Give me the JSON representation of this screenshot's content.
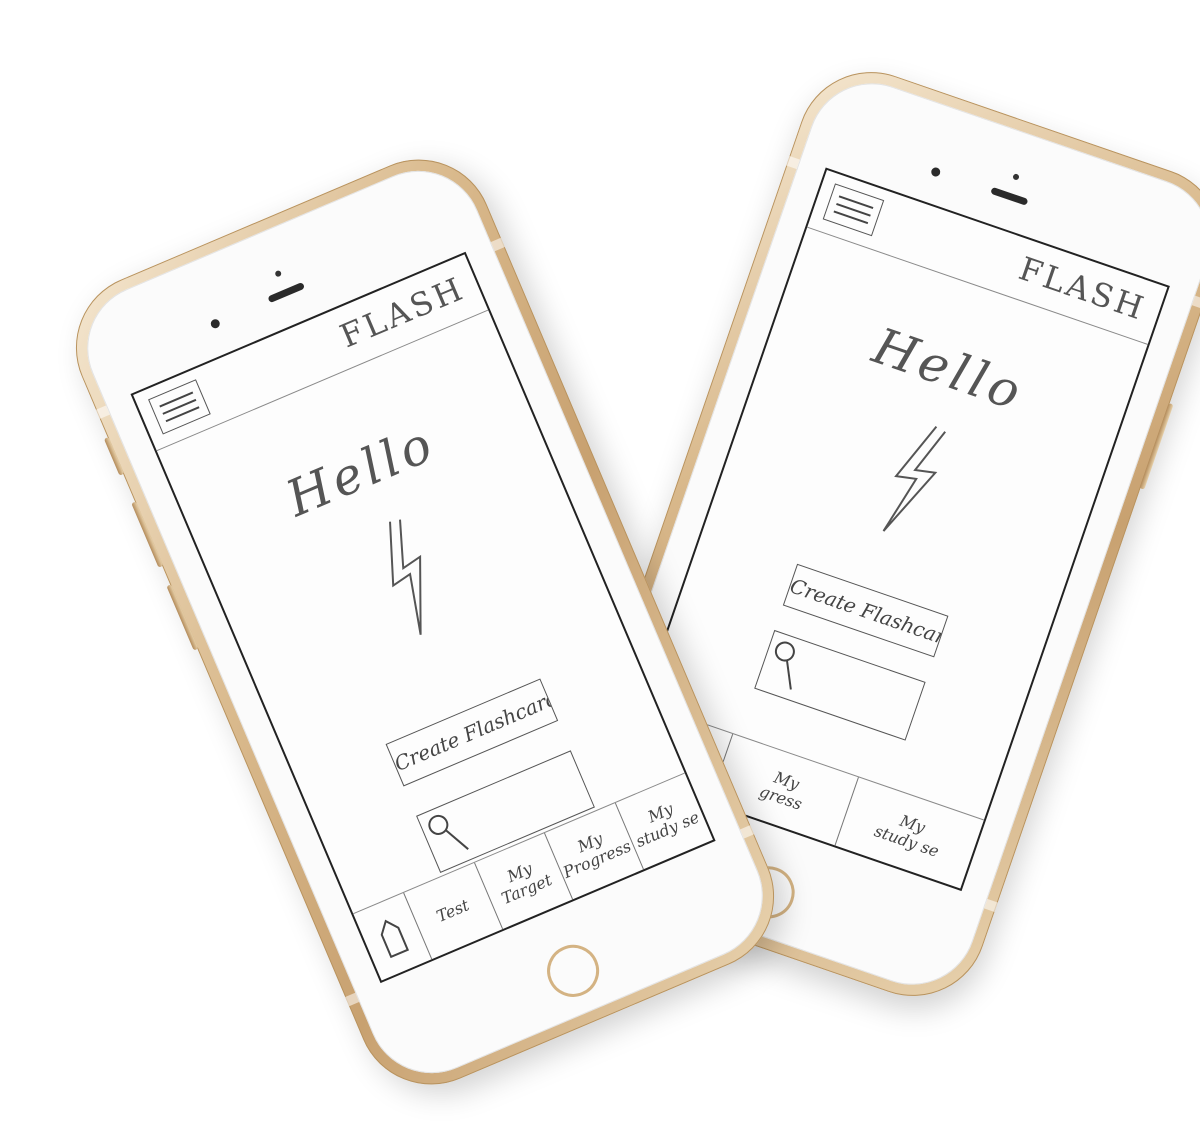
{
  "phone_front": {
    "app_brand": "FLASH",
    "greeting": "Hello",
    "create_button_label": "Create Flashcard",
    "tabs": [
      {
        "label": "Test"
      },
      {
        "label": "My\nTarget"
      },
      {
        "label": "My\nProgress"
      },
      {
        "label": "My\nstudy se"
      }
    ]
  },
  "phone_back": {
    "app_brand": "FLASH",
    "greeting": "Hello",
    "create_button_label": "Create Flashcard",
    "tabs": [
      {
        "label": "My\ngress"
      },
      {
        "label": "My\nstudy se"
      }
    ]
  },
  "icons": {
    "menu": "hamburger-menu-icon",
    "bolt": "lightning-bolt-icon",
    "search": "magnifier-icon",
    "home": "house-icon"
  },
  "colors": {
    "body_gold": "#d9b98c",
    "face": "#fbfbfb",
    "sketch_ink": "#555555"
  }
}
